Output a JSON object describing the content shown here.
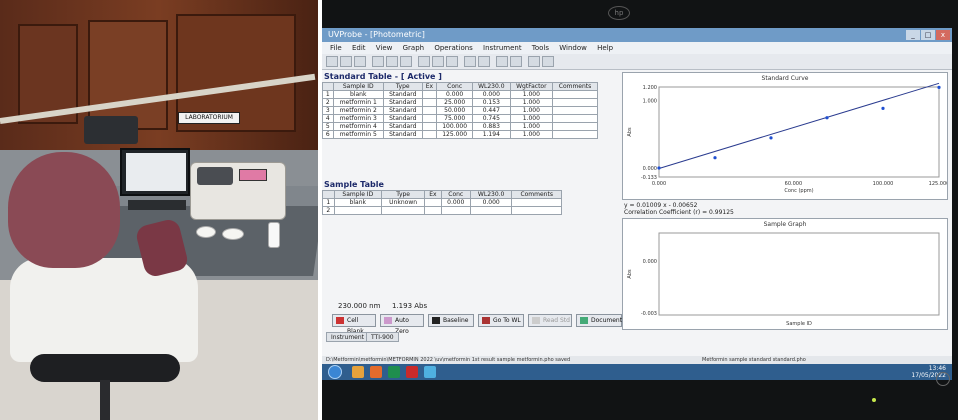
{
  "photo_left": {
    "wall_sign": "LABORATORIUM"
  },
  "monitor": {
    "brand_logo": "hp"
  },
  "app": {
    "title": "UVProbe - [Photometric]",
    "window_controls": [
      "_",
      "□",
      "x"
    ],
    "menu": [
      "File",
      "Edit",
      "View",
      "Graph",
      "Operations",
      "Instrument",
      "Tools",
      "Window",
      "Help"
    ]
  },
  "standard_table": {
    "title": "Standard Table - [ Active ]",
    "columns": [
      "",
      "Sample ID",
      "Type",
      "Ex",
      "Conc",
      "WL230.0",
      "WgtFactor",
      "Comments"
    ],
    "rows": [
      [
        "1",
        "blank",
        "Standard",
        "",
        "0.000",
        "0.000",
        "1.000",
        ""
      ],
      [
        "2",
        "metformin 1",
        "Standard",
        "",
        "25.000",
        "0.153",
        "1.000",
        ""
      ],
      [
        "3",
        "metformin 2",
        "Standard",
        "",
        "50.000",
        "0.447",
        "1.000",
        ""
      ],
      [
        "4",
        "metformin 3",
        "Standard",
        "",
        "75.000",
        "0.745",
        "1.000",
        ""
      ],
      [
        "5",
        "metformin 4",
        "Standard",
        "",
        "100.000",
        "0.883",
        "1.000",
        ""
      ],
      [
        "6",
        "metformin 5",
        "Standard",
        "",
        "125.000",
        "1.194",
        "1.000",
        ""
      ]
    ]
  },
  "sample_table": {
    "title": "Sample Table",
    "columns": [
      "",
      "Sample ID",
      "Type",
      "Ex",
      "Conc",
      "WL230.0",
      "Comments"
    ],
    "rows": [
      [
        "1",
        "blank",
        "Unknown",
        "",
        "0.000",
        "0.000",
        ""
      ],
      [
        "2",
        "",
        "",
        "",
        "",
        "",
        ""
      ]
    ]
  },
  "standard_curve": {
    "title": "Standard Curve",
    "equation": "y = 0.01009 x - 0.00652",
    "correlation": "Correlation Coefficient (r) = 0.99125",
    "x_axis_title": "Conc (ppm)",
    "y_axis_title": "Abs",
    "x_ticks": [
      "0.000",
      "60.000",
      "100.000",
      "125.000"
    ],
    "y_ticks": [
      "-0.133",
      "0.000",
      "1.000",
      "1.200"
    ]
  },
  "sample_graph": {
    "title": "Sample Graph",
    "x_axis_title": "Sample ID",
    "y_axis_title": "Abs",
    "y_ticks": [
      "0.000",
      "-0.003"
    ]
  },
  "readout": {
    "wavelength": "230.000 nm",
    "absorbance": "1.193 Abs"
  },
  "controls": {
    "buttons": [
      "Cell Blank",
      "Auto Zero",
      "Baseline",
      "Go To WL",
      "Read Std",
      "Document"
    ],
    "tabs": [
      "Instrument",
      "TTI-900"
    ]
  },
  "statusbar": {
    "text": "D:\\Metformin\\metformin\\METFORMIN 2022 \\uv\\metformin 1st result sample metformin.pho saved"
  },
  "taskbar": {
    "tray_text": "Metformin sample standard standard.pho",
    "time": "13:46",
    "date": "17/05/2022"
  }
}
